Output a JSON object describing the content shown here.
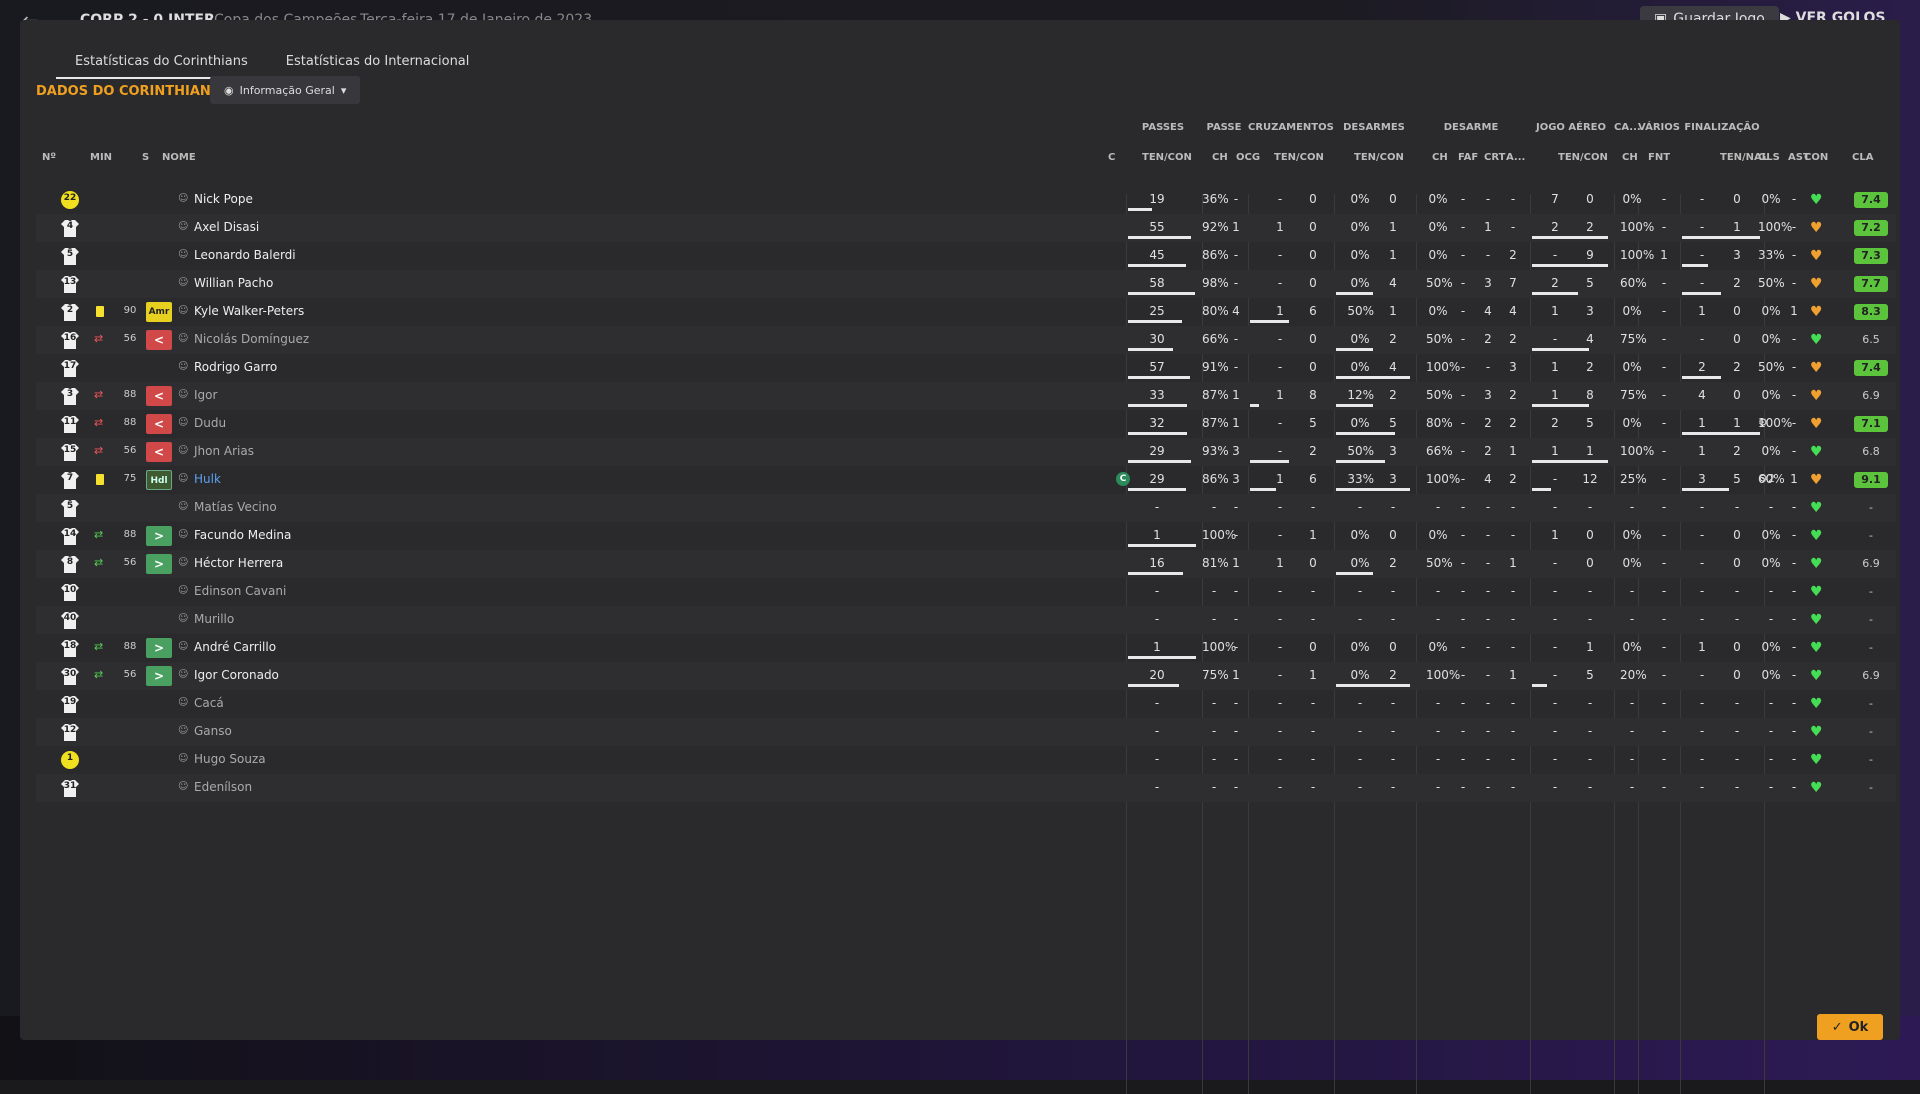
{
  "topbar": {
    "score": "CORP 2 - 0 INTER",
    "competition": "Copa dos Campeões",
    "date": "Terça-feira 17 de Janeiro de 2023",
    "save": "Guardar Jogo",
    "view_goals": "VER GOLOS"
  },
  "tabs": [
    "Estatísticas do Corinthians",
    "Estatísticas do Internacional"
  ],
  "section_title": "DADOS DO CORINTHIANS",
  "dropdown": "Informação Geral",
  "group_headers": [
    "PASSES",
    "PASSE",
    "CRUZAMENTOS",
    "DESARMES",
    "DESARME",
    "JOGO AÉREO",
    "CA...",
    "VÁRIOS",
    "FINALIZAÇÃO"
  ],
  "col_headers": {
    "n": "Nº",
    "min": "MIN",
    "s": "S",
    "nome": "NOME",
    "c": "C",
    "passes": "TEN/CON",
    "ch": "CH",
    "ocg": "OCG",
    "cruz": "TEN/CON",
    "des": "TEN/CON",
    "dch": "CH",
    "faf": "FAF",
    "crt": "CRT",
    "a": "A...",
    "aereo": "TEN/CON",
    "cach": "CH",
    "fnt": "FNT",
    "fin": "TEN/NAL",
    "gls": "GLS",
    "ast": "AST",
    "con": "CON",
    "cla": "CLA"
  },
  "ok": "Ok",
  "players": [
    {
      "n": "22",
      "gk": true,
      "name": "Nick Pope",
      "vals": [
        "19",
        "36%",
        "-",
        "-",
        "0",
        "0%",
        "0",
        "0%",
        "-",
        "-",
        "-",
        "7",
        "0",
        "0%",
        "-",
        "-",
        "0",
        "0%",
        "",
        "-"
      ],
      "bars": [
        36,
        0,
        0,
        0,
        0
      ],
      "heart": "green",
      "rating": "7.4",
      "rg": true
    },
    {
      "n": "4",
      "name": "Axel Disasi",
      "vals": [
        "55",
        "92%",
        "1",
        "1",
        "0",
        "0%",
        "1",
        "0%",
        "-",
        "1",
        "-",
        "2",
        "2",
        "100%",
        "-",
        "-",
        "1",
        "100%",
        "",
        "-"
      ],
      "bars": [
        92,
        0,
        0,
        100,
        100
      ],
      "heart": "orange",
      "rating": "7.2",
      "rg": true
    },
    {
      "n": "5",
      "name": "Leonardo Balerdi",
      "vals": [
        "45",
        "86%",
        "-",
        "-",
        "0",
        "0%",
        "1",
        "0%",
        "-",
        "-",
        "2",
        "-",
        "9",
        "100%",
        "1",
        "-",
        "3",
        "33%",
        "",
        "-"
      ],
      "bars": [
        86,
        0,
        0,
        100,
        33
      ],
      "heart": "orange",
      "rating": "7.3",
      "rg": true
    },
    {
      "n": "13",
      "name": "Willian Pacho",
      "vals": [
        "58",
        "98%",
        "-",
        "-",
        "0",
        "0%",
        "4",
        "50%",
        "-",
        "3",
        "7",
        "2",
        "5",
        "60%",
        "-",
        "-",
        "2",
        "50%",
        "",
        "-"
      ],
      "bars": [
        98,
        0,
        50,
        60,
        50
      ],
      "heart": "orange",
      "rating": "7.7",
      "rg": true
    },
    {
      "n": "2",
      "card": true,
      "min": "90",
      "sbox": "Amr",
      "stype": "pos",
      "name": "Kyle Walker-Peters",
      "vals": [
        "25",
        "80%",
        "4",
        "1",
        "6",
        "50%",
        "1",
        "0%",
        "-",
        "4",
        "4",
        "1",
        "3",
        "0%",
        "-",
        "1",
        "0",
        "0%",
        "",
        "1"
      ],
      "bars": [
        80,
        50,
        0,
        0,
        0
      ],
      "heart": "orange",
      "rating": "8.3",
      "rg": true
    },
    {
      "n": "16",
      "sub": "out",
      "min": "56",
      "sbox": "<",
      "stype": "out",
      "name": "Nicolás Domínguez",
      "dim": true,
      "vals": [
        "30",
        "66%",
        "-",
        "-",
        "0",
        "0%",
        "2",
        "50%",
        "-",
        "2",
        "2",
        "-",
        "4",
        "75%",
        "-",
        "-",
        "0",
        "0%",
        "",
        "-"
      ],
      "bars": [
        66,
        0,
        50,
        75,
        0
      ],
      "heart": "green",
      "rating": "6.5",
      "rg": false
    },
    {
      "n": "17",
      "name": "Rodrigo Garro",
      "vals": [
        "57",
        "91%",
        "-",
        "-",
        "0",
        "0%",
        "4",
        "100%",
        "-",
        "-",
        "3",
        "1",
        "2",
        "0%",
        "-",
        "2",
        "2",
        "50%",
        "",
        "-"
      ],
      "bars": [
        91,
        0,
        100,
        0,
        50
      ],
      "heart": "orange",
      "rating": "7.4",
      "rg": true
    },
    {
      "n": "3",
      "sub": "out",
      "min": "88",
      "sbox": "<",
      "stype": "out",
      "name": "Igor",
      "dim": true,
      "vals": [
        "33",
        "87%",
        "1",
        "1",
        "8",
        "12%",
        "2",
        "50%",
        "-",
        "3",
        "2",
        "1",
        "8",
        "75%",
        "-",
        "4",
        "0",
        "0%",
        "",
        "-"
      ],
      "bars": [
        87,
        12,
        50,
        75,
        0
      ],
      "heart": "orange",
      "rating": "6.9",
      "rg": false
    },
    {
      "n": "11",
      "sub": "out",
      "min": "88",
      "sbox": "<",
      "stype": "out",
      "name": "Dudu",
      "dim": true,
      "vals": [
        "32",
        "87%",
        "1",
        "-",
        "5",
        "0%",
        "5",
        "80%",
        "-",
        "2",
        "2",
        "2",
        "5",
        "0%",
        "-",
        "1",
        "1",
        "100%",
        "⚙",
        "-"
      ],
      "bars": [
        87,
        0,
        80,
        0,
        100
      ],
      "heart": "orange",
      "rating": "7.1",
      "rg": true
    },
    {
      "n": "15",
      "sub": "out",
      "min": "56",
      "sbox": "<",
      "stype": "out",
      "name": "Jhon Arias",
      "dim": true,
      "vals": [
        "29",
        "93%",
        "3",
        "-",
        "2",
        "50%",
        "3",
        "66%",
        "-",
        "2",
        "1",
        "1",
        "1",
        "100%",
        "-",
        "1",
        "2",
        "0%",
        "",
        "-"
      ],
      "bars": [
        93,
        50,
        66,
        100,
        0
      ],
      "heart": "green",
      "rating": "6.8",
      "rg": false
    },
    {
      "n": "7",
      "card": true,
      "min": "75",
      "sbox": "Hdl",
      "stype": "posg",
      "name": "Hulk",
      "blue": true,
      "c": true,
      "vals": [
        "29",
        "86%",
        "3",
        "1",
        "6",
        "33%",
        "3",
        "100%",
        "-",
        "4",
        "2",
        "-",
        "12",
        "25%",
        "-",
        "3",
        "5",
        "60%",
        "⚙2",
        "1"
      ],
      "bars": [
        86,
        33,
        100,
        25,
        60
      ],
      "heart": "orange",
      "rating": "9.1",
      "rg": true
    },
    {
      "n": "5",
      "name": "Matías Vecino",
      "dim": true,
      "vals": [
        "-",
        "-",
        "-",
        "-",
        "-",
        "-",
        "-",
        "-",
        "-",
        "-",
        "-",
        "-",
        "-",
        "-",
        "-",
        "-",
        "-",
        "-",
        "",
        "-"
      ],
      "bars": [
        0,
        0,
        0,
        0,
        0
      ],
      "heart": "green",
      "rating": "-",
      "rg": false
    },
    {
      "n": "14",
      "sub": "in",
      "min": "88",
      "sbox": ">",
      "stype": "in",
      "name": "Facundo Medina",
      "vals": [
        "1",
        "100%",
        "-",
        "-",
        "1",
        "0%",
        "0",
        "0%",
        "-",
        "-",
        "-",
        "1",
        "0",
        "0%",
        "-",
        "-",
        "0",
        "0%",
        "",
        "-"
      ],
      "bars": [
        100,
        0,
        0,
        0,
        0
      ],
      "heart": "green",
      "rating": "-",
      "rg": false
    },
    {
      "n": "8",
      "sub": "in",
      "min": "56",
      "sbox": ">",
      "stype": "in",
      "name": "Héctor Herrera",
      "vals": [
        "16",
        "81%",
        "1",
        "1",
        "0",
        "0%",
        "2",
        "50%",
        "-",
        "-",
        "1",
        "-",
        "0",
        "0%",
        "-",
        "-",
        "0",
        "0%",
        "",
        "-"
      ],
      "bars": [
        81,
        0,
        50,
        0,
        0
      ],
      "heart": "green",
      "rating": "6.9",
      "rg": false
    },
    {
      "n": "10",
      "name": "Edinson Cavani",
      "dim": true,
      "vals": [
        "-",
        "-",
        "-",
        "-",
        "-",
        "-",
        "-",
        "-",
        "-",
        "-",
        "-",
        "-",
        "-",
        "-",
        "-",
        "-",
        "-",
        "-",
        "",
        "-"
      ],
      "bars": [
        0,
        0,
        0,
        0,
        0
      ],
      "heart": "green",
      "rating": "-",
      "rg": false
    },
    {
      "n": "40",
      "name": "Murillo",
      "dim": true,
      "vals": [
        "-",
        "-",
        "-",
        "-",
        "-",
        "-",
        "-",
        "-",
        "-",
        "-",
        "-",
        "-",
        "-",
        "-",
        "-",
        "-",
        "-",
        "-",
        "",
        "-"
      ],
      "bars": [
        0,
        0,
        0,
        0,
        0
      ],
      "heart": "green",
      "rating": "-",
      "rg": false
    },
    {
      "n": "18",
      "sub": "in",
      "min": "88",
      "sbox": ">",
      "stype": "in",
      "name": "André Carrillo",
      "vals": [
        "1",
        "100%",
        "-",
        "-",
        "0",
        "0%",
        "0",
        "0%",
        "-",
        "-",
        "-",
        "-",
        "1",
        "0%",
        "-",
        "1",
        "0",
        "0%",
        "",
        "-"
      ],
      "bars": [
        100,
        0,
        0,
        0,
        0
      ],
      "heart": "green",
      "rating": "-",
      "rg": false
    },
    {
      "n": "30",
      "sub": "in",
      "min": "56",
      "sbox": ">",
      "stype": "in",
      "name": "Igor Coronado",
      "vals": [
        "20",
        "75%",
        "1",
        "-",
        "1",
        "0%",
        "2",
        "100%",
        "-",
        "-",
        "1",
        "-",
        "5",
        "20%",
        "-",
        "-",
        "0",
        "0%",
        "",
        "-"
      ],
      "bars": [
        75,
        0,
        100,
        20,
        0
      ],
      "heart": "green",
      "rating": "6.9",
      "rg": false
    },
    {
      "n": "19",
      "name": "Cacá",
      "dim": true,
      "vals": [
        "-",
        "-",
        "-",
        "-",
        "-",
        "-",
        "-",
        "-",
        "-",
        "-",
        "-",
        "-",
        "-",
        "-",
        "-",
        "-",
        "-",
        "-",
        "",
        "-"
      ],
      "bars": [
        0,
        0,
        0,
        0,
        0
      ],
      "heart": "green",
      "rating": "-",
      "rg": false
    },
    {
      "n": "12",
      "name": "Ganso",
      "dim": true,
      "vals": [
        "-",
        "-",
        "-",
        "-",
        "-",
        "-",
        "-",
        "-",
        "-",
        "-",
        "-",
        "-",
        "-",
        "-",
        "-",
        "-",
        "-",
        "-",
        "",
        "-"
      ],
      "bars": [
        0,
        0,
        0,
        0,
        0
      ],
      "heart": "green",
      "rating": "-",
      "rg": false
    },
    {
      "n": "1",
      "gk": true,
      "name": "Hugo Souza",
      "dim": true,
      "vals": [
        "-",
        "-",
        "-",
        "-",
        "-",
        "-",
        "-",
        "-",
        "-",
        "-",
        "-",
        "-",
        "-",
        "-",
        "-",
        "-",
        "-",
        "-",
        "",
        "-"
      ],
      "bars": [
        0,
        0,
        0,
        0,
        0
      ],
      "heart": "green",
      "rating": "-",
      "rg": false
    },
    {
      "n": "31",
      "name": "Edenílson",
      "dim": true,
      "vals": [
        "-",
        "-",
        "-",
        "-",
        "-",
        "-",
        "-",
        "-",
        "-",
        "-",
        "-",
        "-",
        "-",
        "-",
        "-",
        "-",
        "-",
        "-",
        "",
        "-"
      ],
      "bars": [
        0,
        0,
        0,
        0,
        0
      ],
      "heart": "green",
      "rating": "-",
      "rg": false
    }
  ]
}
